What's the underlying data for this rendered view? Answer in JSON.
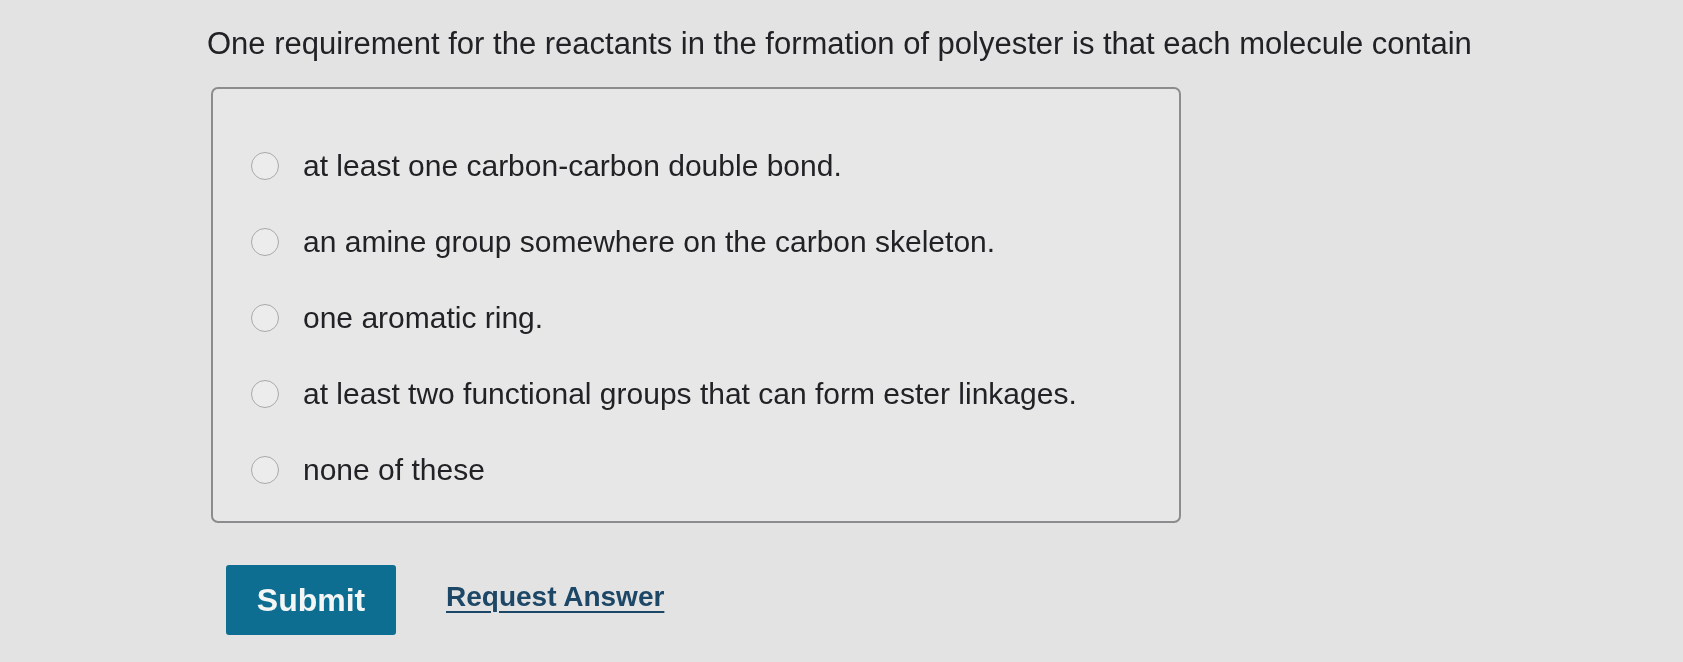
{
  "question": "One requirement for the reactants in the formation of polyester is that each molecule contain",
  "options": [
    {
      "label": "at least one carbon-carbon double bond.",
      "selected": false
    },
    {
      "label": "an amine group somewhere on the carbon skeleton.",
      "selected": false
    },
    {
      "label": "one aromatic ring.",
      "selected": false
    },
    {
      "label": "at least two functional groups that can form ester linkages.",
      "selected": false
    },
    {
      "label": "none of these",
      "selected": false
    }
  ],
  "submit_button": {
    "label": "Submit"
  },
  "request_answer_link": {
    "label": "Request Answer"
  }
}
